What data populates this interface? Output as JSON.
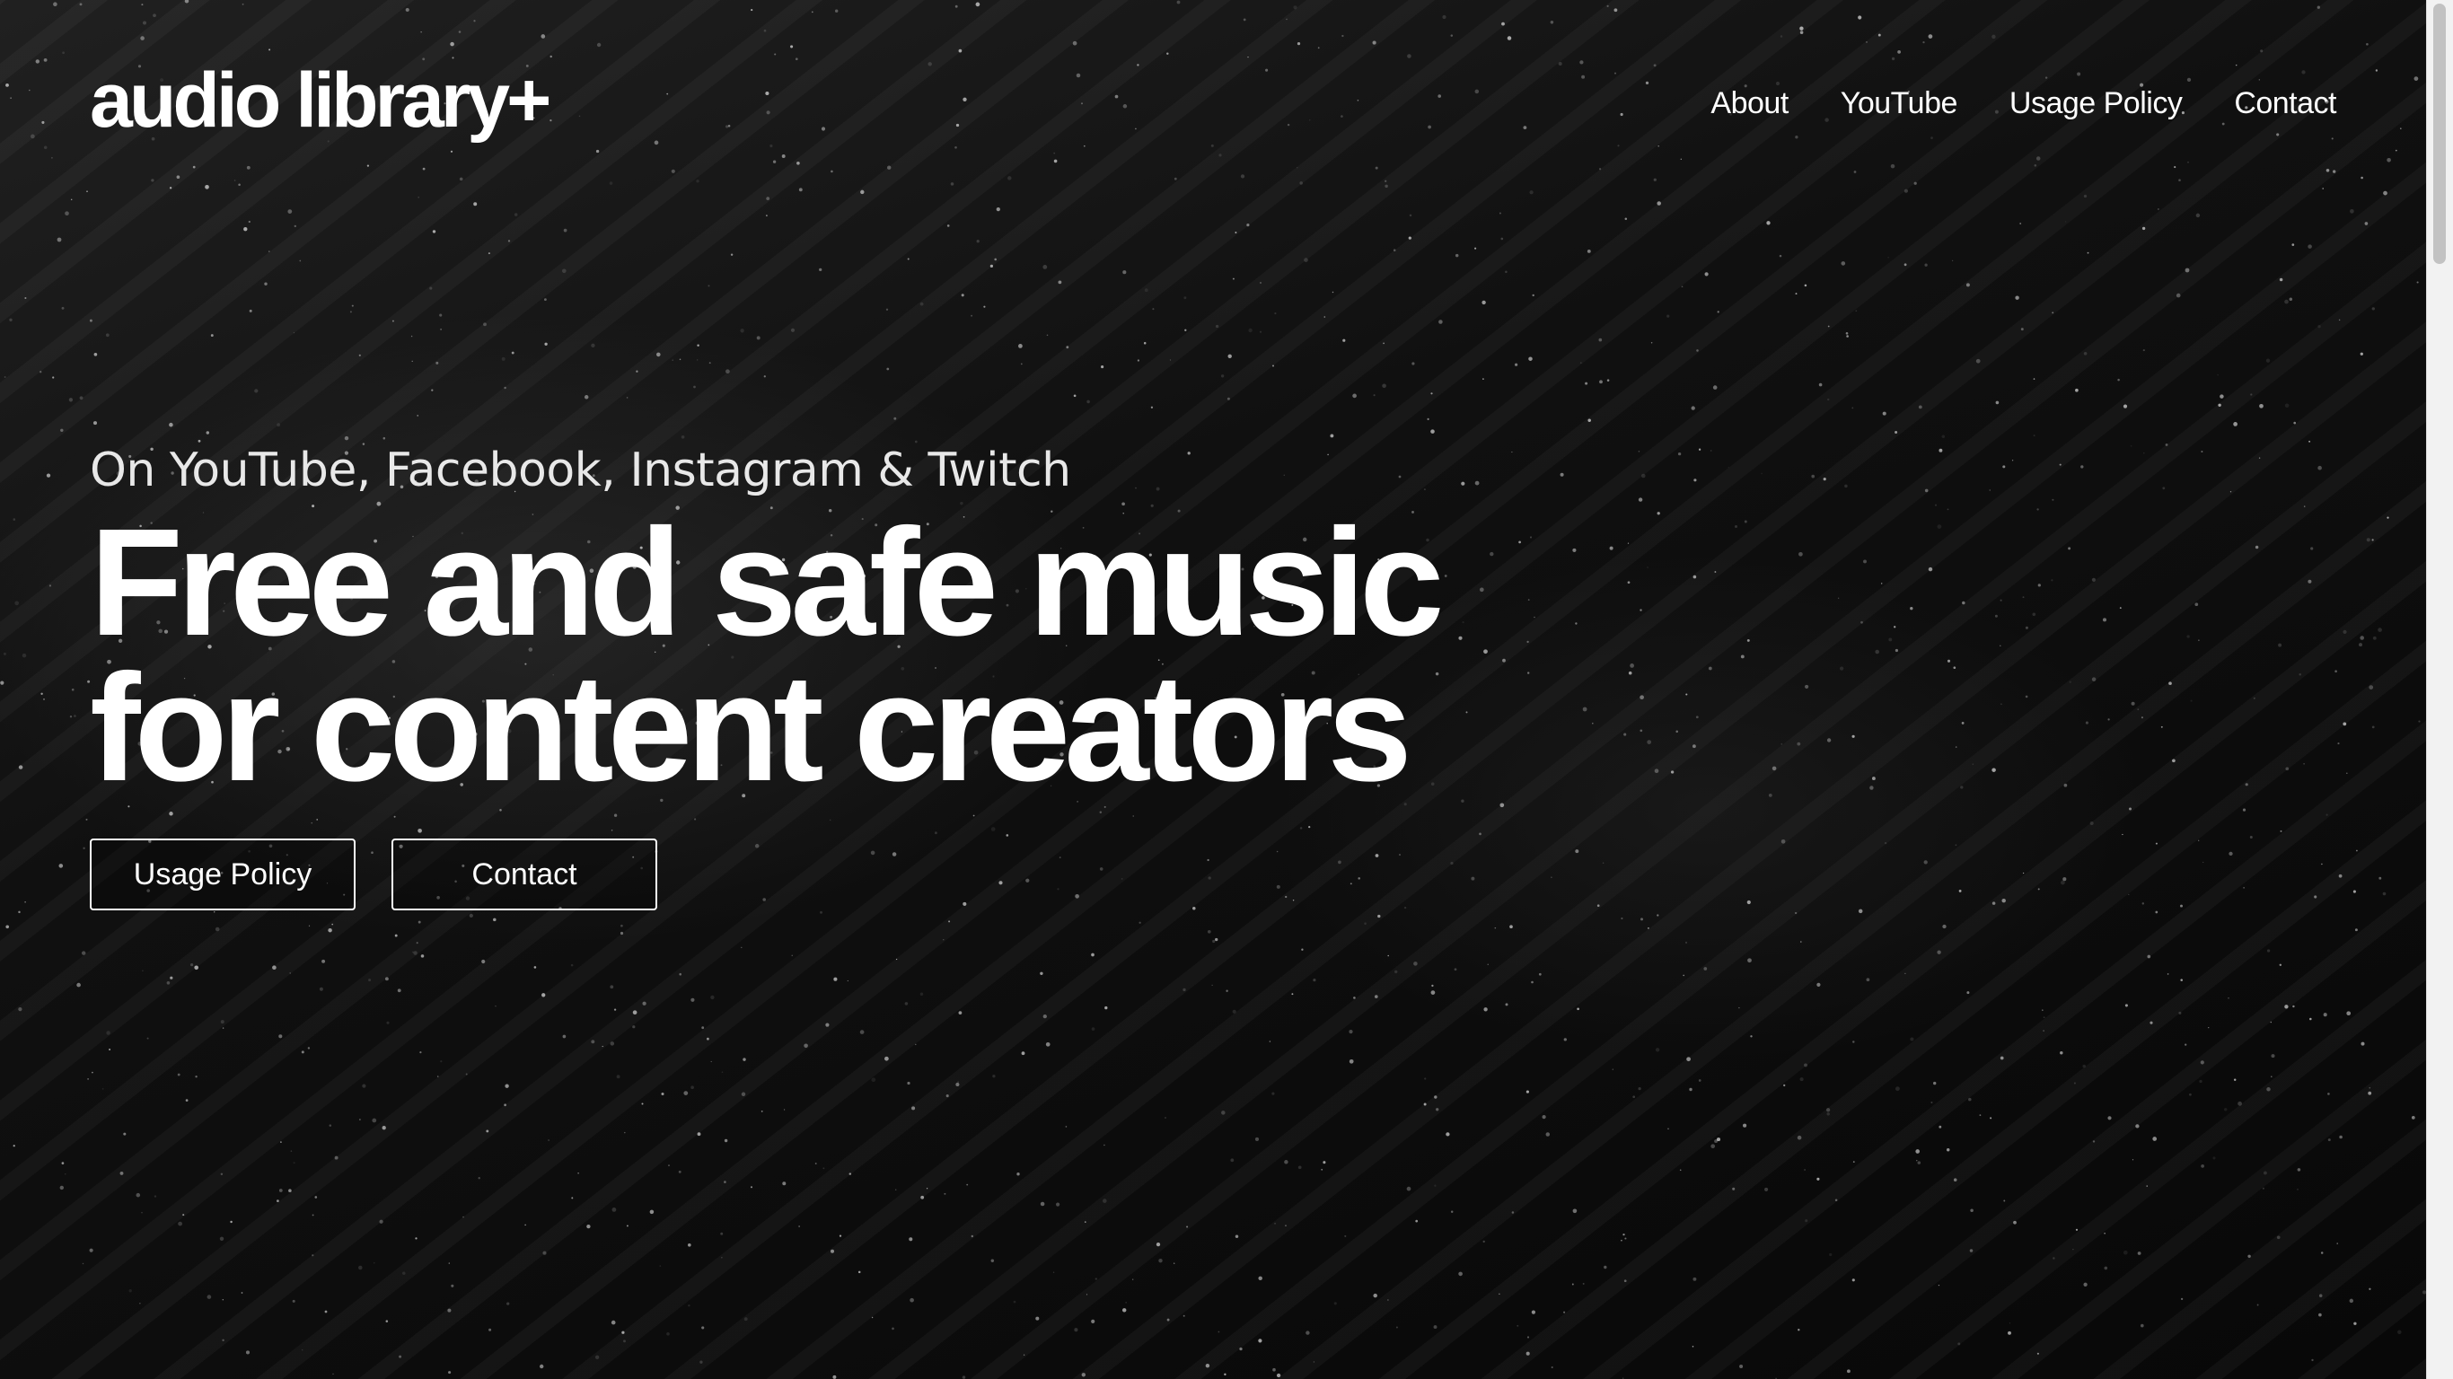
{
  "header": {
    "logo_text": "audio library+",
    "nav": [
      {
        "label": "About"
      },
      {
        "label": "YouTube"
      },
      {
        "label": "Usage Policy"
      },
      {
        "label": "Contact"
      }
    ]
  },
  "hero": {
    "subtitle": "On YouTube, Facebook, Instagram & Twitch",
    "headline": "Free and safe music for content creators",
    "buttons": [
      {
        "label": "Usage Policy"
      },
      {
        "label": "Contact"
      }
    ]
  },
  "colors": {
    "background": "#0b0b0b",
    "text": "#ffffff",
    "scrollbar_track": "#f2f2f2",
    "scrollbar_thumb": "#c2c2c2"
  },
  "scroll": {
    "position_fraction": 0.0
  }
}
